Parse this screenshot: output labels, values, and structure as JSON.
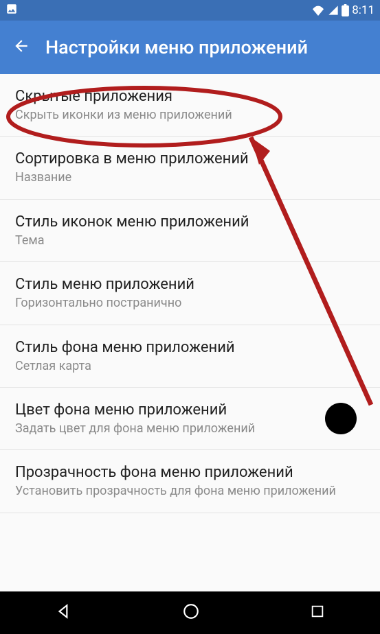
{
  "status": {
    "time": "8:11"
  },
  "header": {
    "title": "Настройки меню приложений"
  },
  "items": [
    {
      "title": "Скрытые приложения",
      "sub": "Скрыть иконки из меню приложений"
    },
    {
      "title": "Сортировка в меню приложений",
      "sub": "Название"
    },
    {
      "title": "Стиль иконок меню приложений",
      "sub": "Тема"
    },
    {
      "title": "Стиль меню приложений",
      "sub": "Горизонтально постранично"
    },
    {
      "title": "Стиль фона меню приложений",
      "sub": "Сетлая карта"
    },
    {
      "title": "Цвет фона меню приложений",
      "sub": "Задать цвет для фона меню приложений",
      "swatch": "#000000"
    },
    {
      "title": "Прозрачность фона меню приложений",
      "sub": "Установить прозрачность для фона меню приложений"
    }
  ]
}
